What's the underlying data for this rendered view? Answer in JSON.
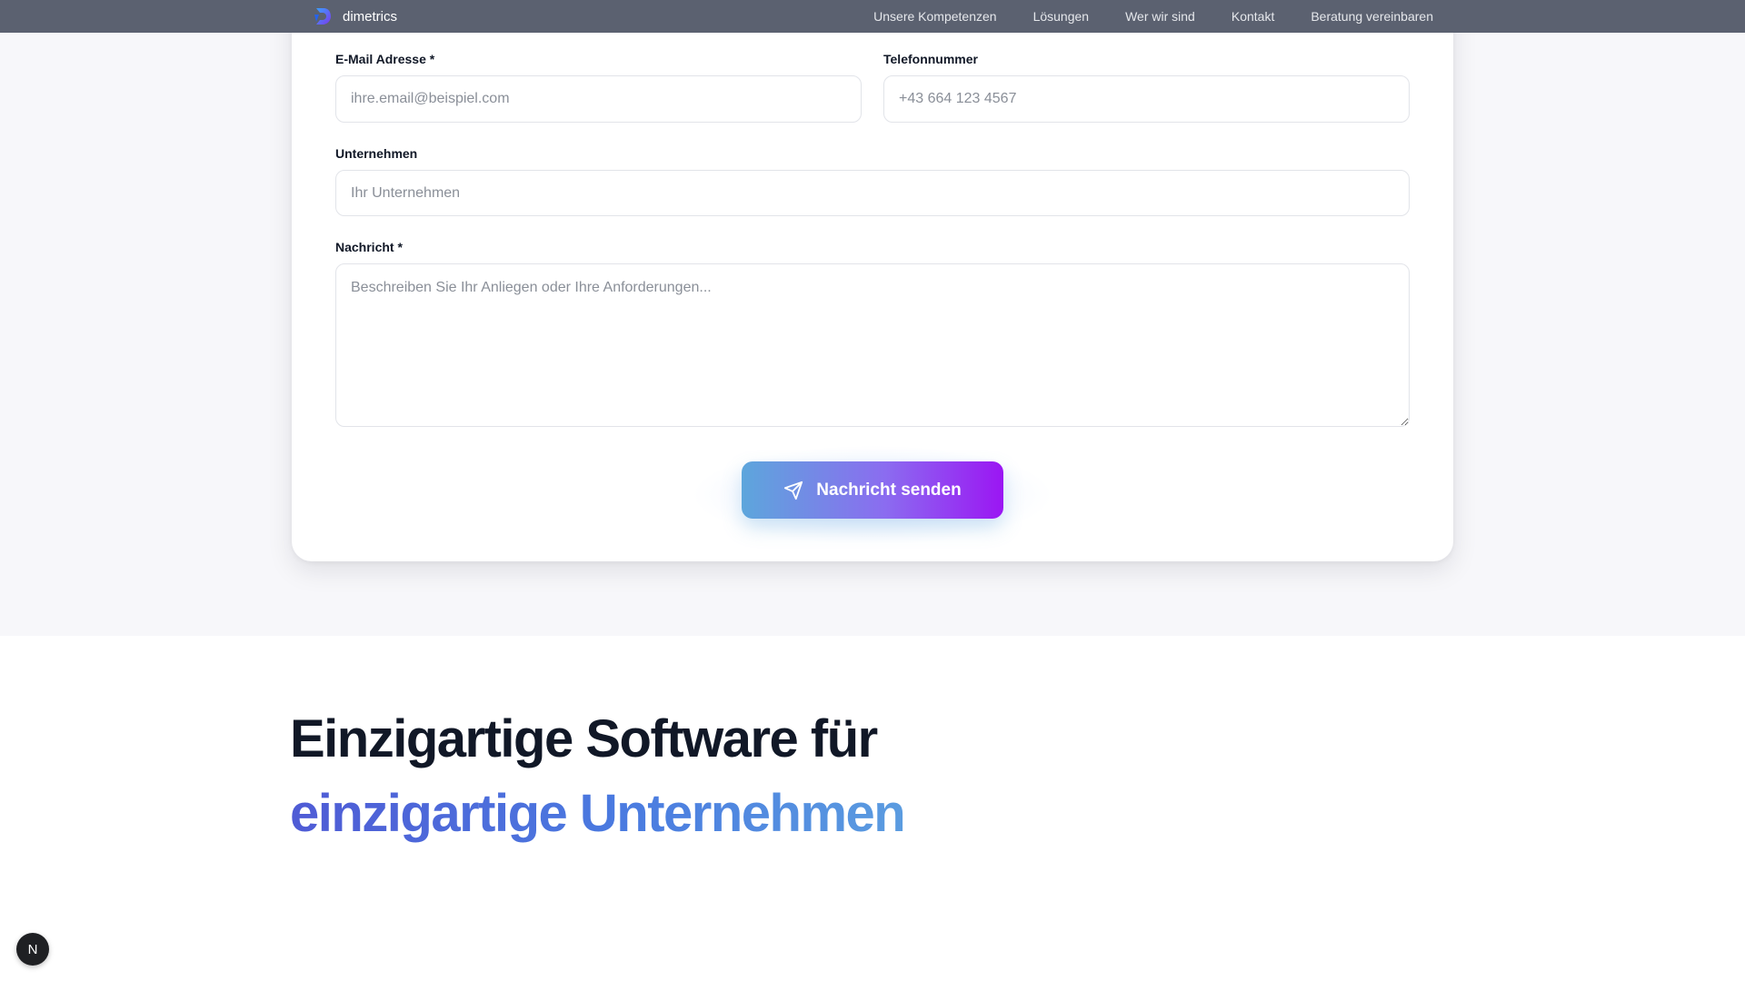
{
  "nav": {
    "brand": "dimetrics",
    "links": [
      "Unsere Kompetenzen",
      "Lösungen",
      "Wer wir sind",
      "Kontakt",
      "Beratung vereinbaren"
    ]
  },
  "form": {
    "email_label": "E-Mail Adresse *",
    "email_placeholder": "ihre.email@beispiel.com",
    "phone_label": "Telefonnummer",
    "phone_placeholder": "+43 664 123 4567",
    "company_label": "Unternehmen",
    "company_placeholder": "Ihr Unternehmen",
    "message_label": "Nachricht *",
    "message_placeholder": "Beschreiben Sie Ihr Anliegen oder Ihre Anforderungen...",
    "submit_label": "Nachricht senden",
    "submit_icon": "send-icon"
  },
  "hero": {
    "line1": "Einzigartige Software für",
    "line2": "einzigartige Unternehmen"
  },
  "badge": {
    "letter": "N"
  },
  "colors": {
    "nav_bg": "#5b6170",
    "section_bg": "#f7f7fa",
    "button_gradient_start": "#5da6dc",
    "button_gradient_end": "#9b16f3",
    "hero_gradient_start": "#4f5bd5",
    "hero_gradient_end": "#5b9ce0"
  }
}
